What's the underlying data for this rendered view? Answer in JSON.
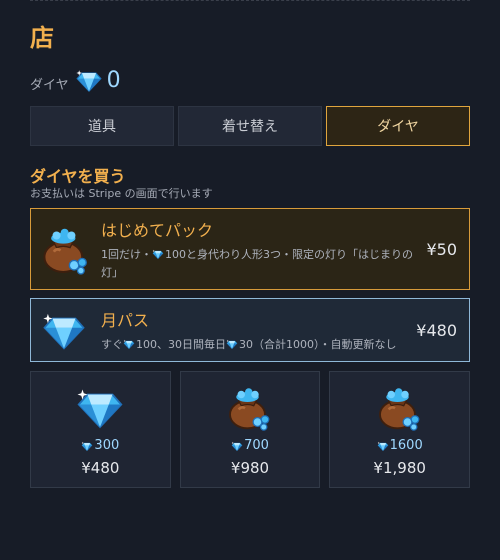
{
  "header": {
    "title": "店"
  },
  "balance": {
    "label": "ダイヤ",
    "value": "0",
    "icon": "diamond-icon"
  },
  "tabs": [
    {
      "label": "道具",
      "active": false
    },
    {
      "label": "着せ替え",
      "active": false
    },
    {
      "label": "ダイヤ",
      "active": true
    }
  ],
  "section": {
    "title": "ダイヤを買う",
    "subtitle": "お支払いは Stripe の画面で行います"
  },
  "offers": {
    "starter": {
      "name": "はじめてパック",
      "desc_pre": "1回だけ・",
      "desc_amount": "100",
      "desc_post": "と身代わり人形3つ・限定の灯り「はじまりの灯」",
      "price": "¥50",
      "icon": "gem-bag-icon"
    },
    "monthly": {
      "name": "月パス",
      "desc_pre": "すぐ",
      "desc_amount1": "100",
      "desc_mid": "、30日間毎日",
      "desc_amount2": "30",
      "desc_post": "（合計1000）・自動更新なし",
      "price": "¥480",
      "icon": "diamond-icon"
    }
  },
  "packs": [
    {
      "amount": "300",
      "price": "¥480",
      "icon": "diamond-icon"
    },
    {
      "amount": "700",
      "price": "¥980",
      "icon": "gem-bag-icon"
    },
    {
      "amount": "1600",
      "price": "¥1,980",
      "icon": "gem-bag-icon"
    }
  ],
  "colors": {
    "accent": "#f2b04e",
    "gem": "#9fd8ff",
    "selected_border": "#e0a53d"
  }
}
